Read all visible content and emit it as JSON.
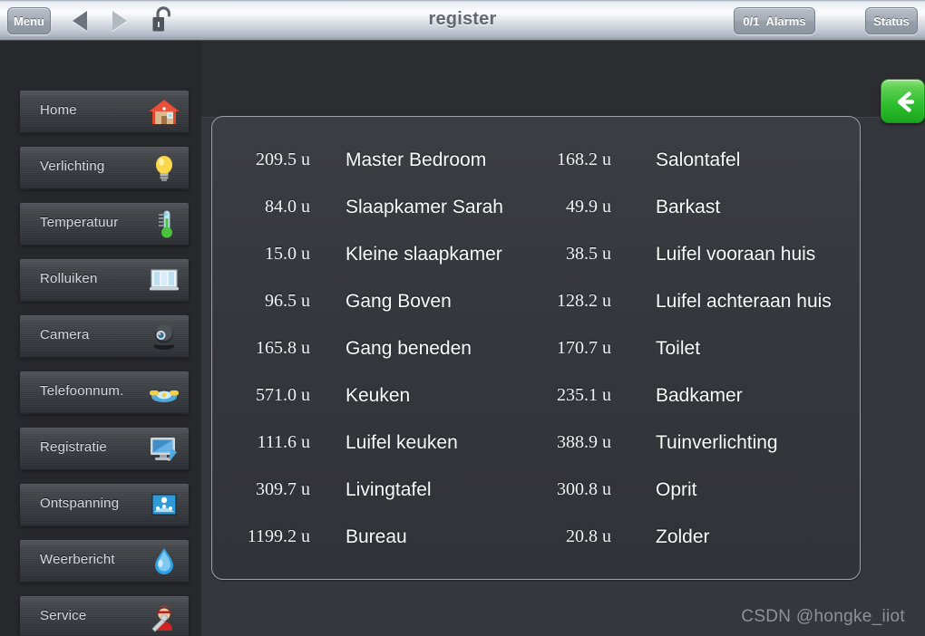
{
  "titlebar": {
    "title": "register",
    "menu_label": "Menu",
    "alarms_count": "0/1",
    "alarms_label": "Alarms",
    "status_label": "Status",
    "back_arrow_icon": "triangle-left-icon",
    "forward_arrow_icon": "triangle-right-icon",
    "lock_icon": "unlocked-padlock-icon"
  },
  "sidebar": {
    "items": [
      {
        "label": "Home",
        "icon": "house-icon"
      },
      {
        "label": "Verlichting",
        "icon": "lightbulb-icon"
      },
      {
        "label": "Temperatuur",
        "icon": "thermometer-icon"
      },
      {
        "label": "Rolluiken",
        "icon": "window-blinds-icon"
      },
      {
        "label": "Camera",
        "icon": "camera-icon"
      },
      {
        "label": "Telefoonnum.",
        "icon": "telephone-icon"
      },
      {
        "label": "Registratie",
        "icon": "monitor-pencil-icon"
      },
      {
        "label": "Ontspanning",
        "icon": "fountain-icon"
      },
      {
        "label": "Weerbericht",
        "icon": "water-drop-icon"
      },
      {
        "label": "Service",
        "icon": "mechanic-wrench-icon"
      }
    ]
  },
  "back_button": {
    "icon": "arrow-left-icon",
    "color": "#2fc02f"
  },
  "register_table": {
    "unit": "u",
    "column_left": [
      {
        "value": "209.5 u",
        "name": "Master Bedroom"
      },
      {
        "value": "84.0 u",
        "name": "Slaapkamer Sarah"
      },
      {
        "value": "15.0 u",
        "name": "Kleine slaapkamer"
      },
      {
        "value": "96.5 u",
        "name": "Gang Boven"
      },
      {
        "value": "165.8 u",
        "name": "Gang beneden"
      },
      {
        "value": "571.0 u",
        "name": "Keuken"
      },
      {
        "value": "111.6 u",
        "name": "Luifel keuken"
      },
      {
        "value": "309.7 u",
        "name": "Livingtafel"
      },
      {
        "value": "1199.2 u",
        "name": "Bureau"
      }
    ],
    "column_right": [
      {
        "value": "168.2 u",
        "name": "Salontafel"
      },
      {
        "value": "49.9 u",
        "name": "Barkast"
      },
      {
        "value": "38.5 u",
        "name": "Luifel vooraan huis"
      },
      {
        "value": "128.2 u",
        "name": "Luifel achteraan huis"
      },
      {
        "value": "170.7 u",
        "name": "Toilet"
      },
      {
        "value": "235.1 u",
        "name": "Badkamer"
      },
      {
        "value": "388.9 u",
        "name": "Tuinverlichting"
      },
      {
        "value": "300.8 u",
        "name": "Oprit"
      },
      {
        "value": "20.8 u",
        "name": "Zolder"
      }
    ]
  },
  "watermark": {
    "text": "CSDN @hongke_iiot"
  }
}
